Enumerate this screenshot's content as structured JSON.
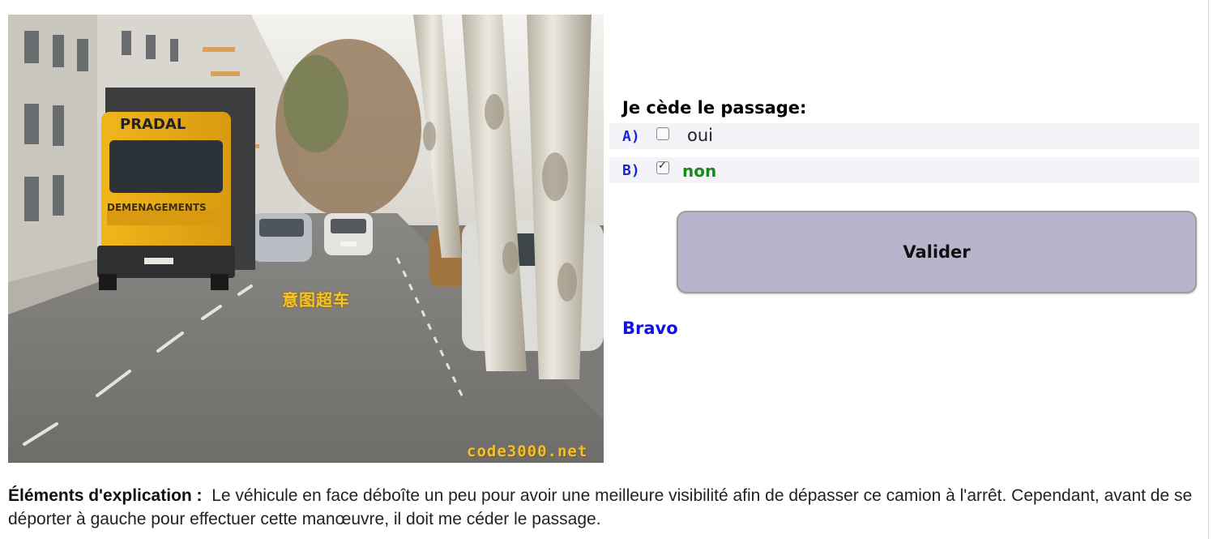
{
  "photo": {
    "caption": "意图超车",
    "watermark": "code3000.net",
    "truck_top_text": "PRADAL",
    "truck_side_text": "DEMENAGEMENTS"
  },
  "question": {
    "title": "Je cède le passage:",
    "answers": [
      {
        "letter": "A)",
        "text": "oui",
        "checked": false
      },
      {
        "letter": "B)",
        "text": "non",
        "checked": true
      }
    ],
    "check_mark": "✓",
    "submit_label": "Valider",
    "result": "Bravo"
  },
  "explanation": {
    "label": "Éléments d'explication :",
    "text": "Le véhicule en face déboîte un peu pour avoir une meilleure visibilité afin de dépasser ce camion à l'arrêt. Cependant, avant de se déporter à gauche pour effectuer cette manœuvre, il doit me céder le passage."
  },
  "colors": {
    "letter": "#1a24d9",
    "correct": "#1a8a1a",
    "result": "#1414e0",
    "button": "#b6b5cb"
  }
}
